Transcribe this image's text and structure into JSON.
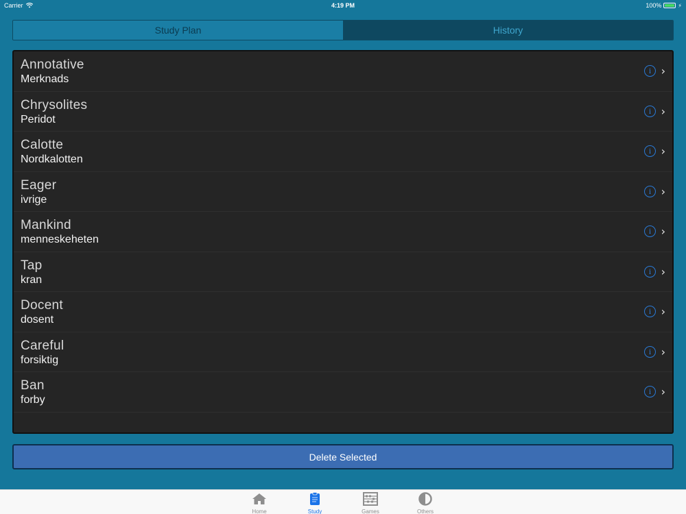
{
  "status_bar": {
    "carrier": "Carrier",
    "time": "4:19 PM",
    "battery": "100%"
  },
  "segments": [
    {
      "label": "Study Plan",
      "active": true
    },
    {
      "label": "History",
      "active": false
    }
  ],
  "words": [
    {
      "word": "Annotative",
      "translation": "Merknads"
    },
    {
      "word": "Chrysolites",
      "translation": "Peridot"
    },
    {
      "word": "Calotte",
      "translation": "Nordkalotten"
    },
    {
      "word": "Eager",
      "translation": "ivrige"
    },
    {
      "word": "Mankind",
      "translation": "menneskeheten"
    },
    {
      "word": "Tap",
      "translation": "kran"
    },
    {
      "word": "Docent",
      "translation": "dosent"
    },
    {
      "word": "Careful",
      "translation": "forsiktig"
    },
    {
      "word": "Ban",
      "translation": "forby"
    }
  ],
  "delete_button": "Delete Selected",
  "tabs": [
    {
      "label": "Home",
      "icon": "home-icon",
      "active": false
    },
    {
      "label": "Study",
      "icon": "clipboard-icon",
      "active": true
    },
    {
      "label": "Games",
      "icon": "abacus-icon",
      "active": false
    },
    {
      "label": "Others",
      "icon": "half-circle-icon",
      "active": false
    }
  ],
  "colors": {
    "background": "#15779b",
    "list_background": "#252525",
    "accent": "#1a73e8",
    "delete_button": "#3c6db3"
  }
}
